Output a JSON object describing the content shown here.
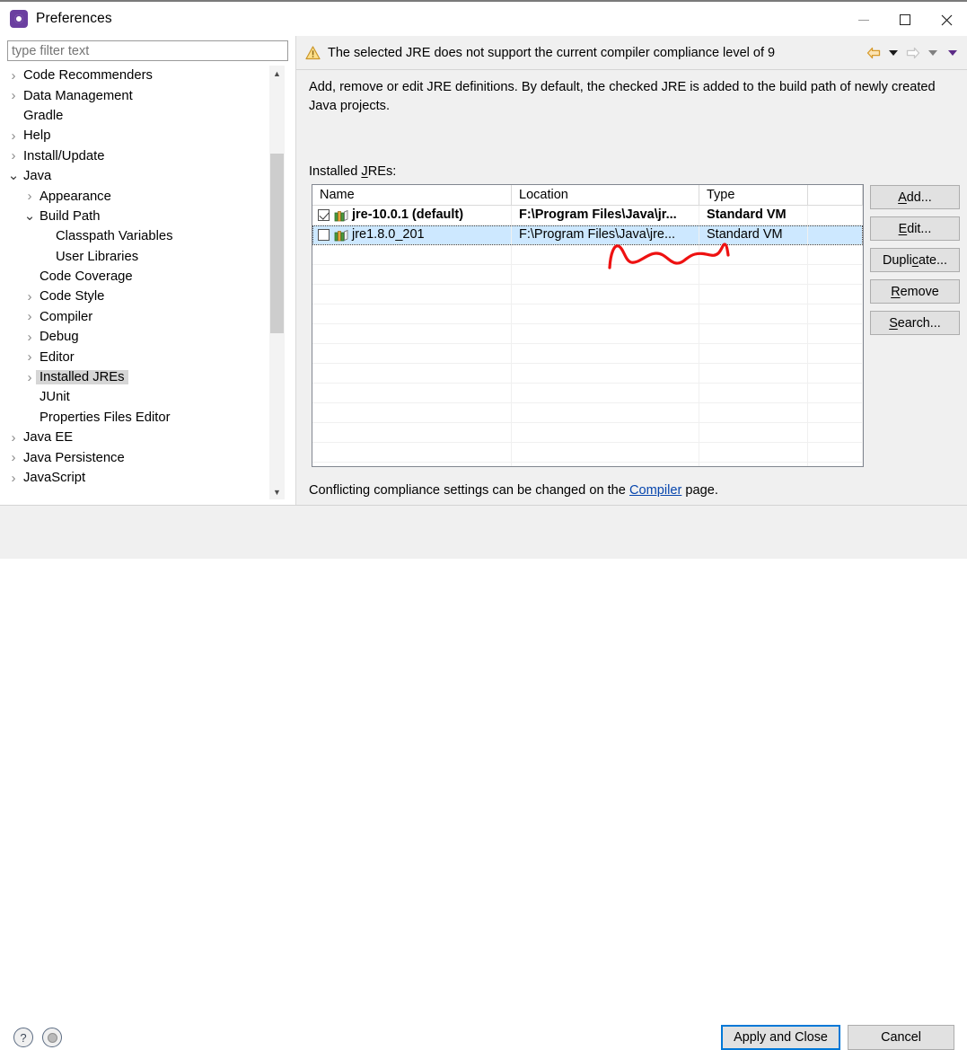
{
  "window": {
    "title": "Preferences",
    "icon": "preferences-gear-icon",
    "controls": {
      "minimize": "—",
      "maximize": "□",
      "close": "✕"
    }
  },
  "sidebar": {
    "filter": {
      "placeholder": "type filter text",
      "value": ""
    },
    "items": [
      {
        "label": "Code Recommenders",
        "indent": 0,
        "state": "collapsed"
      },
      {
        "label": "Data Management",
        "indent": 0,
        "state": "collapsed"
      },
      {
        "label": "Gradle",
        "indent": 0,
        "state": "leaf"
      },
      {
        "label": "Help",
        "indent": 0,
        "state": "collapsed"
      },
      {
        "label": "Install/Update",
        "indent": 0,
        "state": "collapsed"
      },
      {
        "label": "Java",
        "indent": 0,
        "state": "expanded"
      },
      {
        "label": "Appearance",
        "indent": 1,
        "state": "collapsed"
      },
      {
        "label": "Build Path",
        "indent": 1,
        "state": "expanded"
      },
      {
        "label": "Classpath Variables",
        "indent": 2,
        "state": "leaf"
      },
      {
        "label": "User Libraries",
        "indent": 2,
        "state": "leaf"
      },
      {
        "label": "Code Coverage",
        "indent": 1,
        "state": "leaf"
      },
      {
        "label": "Code Style",
        "indent": 1,
        "state": "collapsed"
      },
      {
        "label": "Compiler",
        "indent": 1,
        "state": "collapsed"
      },
      {
        "label": "Debug",
        "indent": 1,
        "state": "collapsed"
      },
      {
        "label": "Editor",
        "indent": 1,
        "state": "collapsed"
      },
      {
        "label": "Installed JREs",
        "indent": 1,
        "state": "collapsed",
        "selected": true
      },
      {
        "label": "JUnit",
        "indent": 1,
        "state": "leaf"
      },
      {
        "label": "Properties Files Editor",
        "indent": 1,
        "state": "leaf"
      },
      {
        "label": "Java EE",
        "indent": 0,
        "state": "collapsed"
      },
      {
        "label": "Java Persistence",
        "indent": 0,
        "state": "collapsed"
      },
      {
        "label": "JavaScript",
        "indent": 0,
        "state": "collapsed"
      }
    ]
  },
  "warning": {
    "icon": "warning-triangle-icon",
    "text": "The selected JRE does not support the current compiler compliance level of 9",
    "nav": {
      "back_icon": "back-arrow-icon",
      "back_menu_icon": "chevron-down-icon",
      "forward_icon": "forward-arrow-icon",
      "forward_menu_icon": "chevron-down-icon",
      "more_menu_icon": "chevron-down-icon",
      "back_color": "#e8a33d",
      "forward_color": "#c9c9c9",
      "more_color": "#5b2a86"
    }
  },
  "page": {
    "description": "Add, remove or edit JRE definitions. By default, the checked JRE is added to the build path of newly created Java projects.",
    "table_label_pre": "Installed ",
    "table_label_mnemonic": "J",
    "table_label_post": "REs:",
    "conflict_pre": "Conflicting compliance settings can be changed on the ",
    "conflict_link": "Compiler",
    "conflict_post": " page.",
    "apply_label_pre": "",
    "apply_label_mnemonic": "A",
    "apply_label_post": "pply"
  },
  "table": {
    "columns": [
      "Name",
      "Location",
      "Type",
      ""
    ],
    "rows": [
      {
        "checked": true,
        "bold": true,
        "selected": false,
        "icon": "jre-library-icon",
        "name": "jre-10.0.1 (default)",
        "location": "F:\\Program Files\\Java\\jr...",
        "type": "Standard VM"
      },
      {
        "checked": false,
        "bold": false,
        "selected": true,
        "icon": "jre-library-icon",
        "name": "jre1.8.0_201",
        "location": "F:\\Program Files\\Java\\jre...",
        "type": "Standard VM"
      }
    ],
    "empty_row_count": 12,
    "selection_color": "#cde8ff",
    "annotation": "red-handdrawn-underline"
  },
  "side_buttons": [
    {
      "pre": "",
      "mnemonic": "A",
      "post": "dd..."
    },
    {
      "pre": "",
      "mnemonic": "E",
      "post": "dit..."
    },
    {
      "pre": "Dupli",
      "mnemonic": "c",
      "post": "ate..."
    },
    {
      "pre": "",
      "mnemonic": "R",
      "post": "emove"
    },
    {
      "pre": "",
      "mnemonic": "S",
      "post": "earch..."
    }
  ],
  "footer": {
    "help_icon": "help-question-icon",
    "restore_icon": "restore-defaults-icon",
    "apply_and_close": "Apply and Close",
    "cancel": "Cancel",
    "focus_color": "#0078d7"
  }
}
